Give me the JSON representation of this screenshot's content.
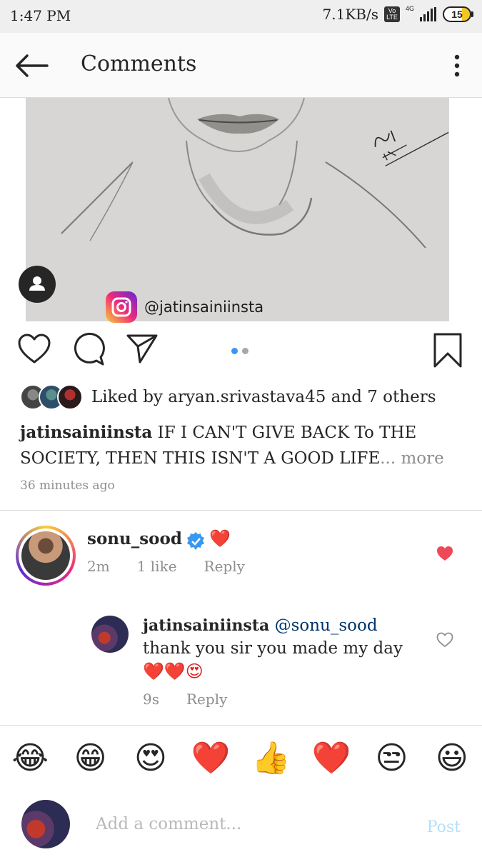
{
  "status_bar": {
    "time": "1:47 PM",
    "net_speed": "7.1KB/s",
    "volte_top": "Vo",
    "volte_bottom": "LTE",
    "network_type": "4G",
    "battery": "15"
  },
  "header": {
    "title": "Comments",
    "back_icon": "arrow-left-icon",
    "menu_icon": "more-vertical-icon"
  },
  "post": {
    "image_watermark": "@jatinsainiinsta",
    "carousel_dots": 2,
    "carousel_active": 0,
    "liked_by": "Liked by aryan.srivastava45 and 7 others",
    "caption_user": "jatinsainiinsta",
    "caption_text": "IF I CAN'T GIVE BACK To THE SOCIETY, THEN THIS ISN'T A GOOD LIFE",
    "caption_ellipsis": "...",
    "caption_more": "more",
    "timestamp": "36 minutes ago"
  },
  "comments": [
    {
      "user": "sonu_sood",
      "verified": true,
      "text": "❤️",
      "time": "2m",
      "likes": "1 like",
      "reply_label": "Reply",
      "liked": true
    }
  ],
  "replies": [
    {
      "user": "jatinsainiinsta",
      "mention": "@sonu_sood",
      "text_line1": "thank you sir you made my day",
      "text_line2": "❤️❤️😍",
      "time": "9s",
      "reply_label": "Reply",
      "liked": false
    }
  ],
  "emoji_bar": [
    "😂",
    "😁",
    "😍",
    "❤️",
    "👍",
    "❤️",
    "😒",
    "😃"
  ],
  "composer": {
    "placeholder": "Add a comment...",
    "post_label": "Post"
  },
  "colors": {
    "accent_blue": "#3897f0",
    "like_red": "#ed4956",
    "verified_blue": "#3897f0",
    "post_disabled": "#b2dffc"
  }
}
